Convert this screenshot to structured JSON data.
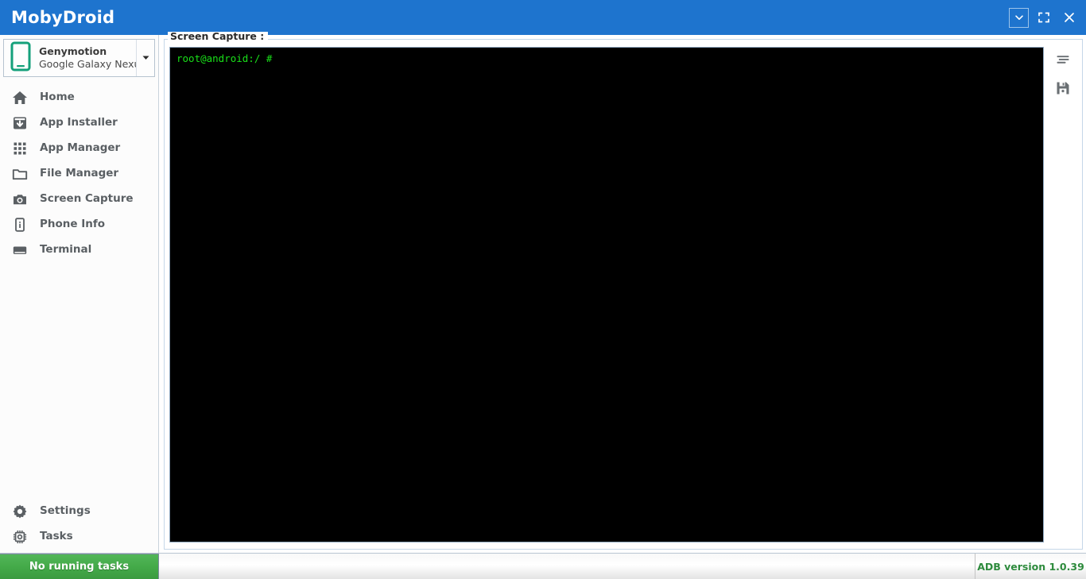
{
  "window": {
    "title": "MobyDroid",
    "controls": [
      {
        "name": "minimize-button",
        "icon": "chevron-down-icon"
      },
      {
        "name": "maximize-button",
        "icon": "fullscreen-icon"
      },
      {
        "name": "close-button",
        "icon": "close-icon"
      }
    ]
  },
  "sidebar": {
    "device": {
      "name": "Genymotion",
      "model": "Google Galaxy Nexus",
      "icon": "phone-icon",
      "arrow_icon": "chevron-down-icon"
    },
    "items": [
      {
        "label": "Home",
        "icon": "home-icon"
      },
      {
        "label": "App Installer",
        "icon": "download-box-icon"
      },
      {
        "label": "App Manager",
        "icon": "grid-icon"
      },
      {
        "label": "File Manager",
        "icon": "folder-icon"
      },
      {
        "label": "Screen Capture",
        "icon": "camera-icon"
      },
      {
        "label": "Phone Info",
        "icon": "phone-info-icon"
      },
      {
        "label": "Terminal",
        "icon": "terminal-icon"
      }
    ],
    "bottom_items": [
      {
        "label": "Settings",
        "icon": "gear-icon"
      },
      {
        "label": "Tasks",
        "icon": "cpu-gear-icon"
      }
    ]
  },
  "main": {
    "group_title": "Screen Capture :",
    "terminal": {
      "lines": [
        "root@android:/ #"
      ],
      "text_color": "#19e019",
      "background": "#000000"
    },
    "tools": [
      {
        "name": "clear-lines-button",
        "icon": "lines-icon"
      },
      {
        "name": "save-button",
        "icon": "floppy-save-icon"
      }
    ]
  },
  "statusbar": {
    "tasks_label": "No running tasks",
    "adb_version": "ADB version 1.0.39"
  },
  "colors": {
    "titlebar": "#1e74ce",
    "accent_green": "#43a948",
    "adb_green": "#2e8b3d",
    "sidebar_bg": "#fcfcfc",
    "device_icon": "#1aa07a"
  }
}
